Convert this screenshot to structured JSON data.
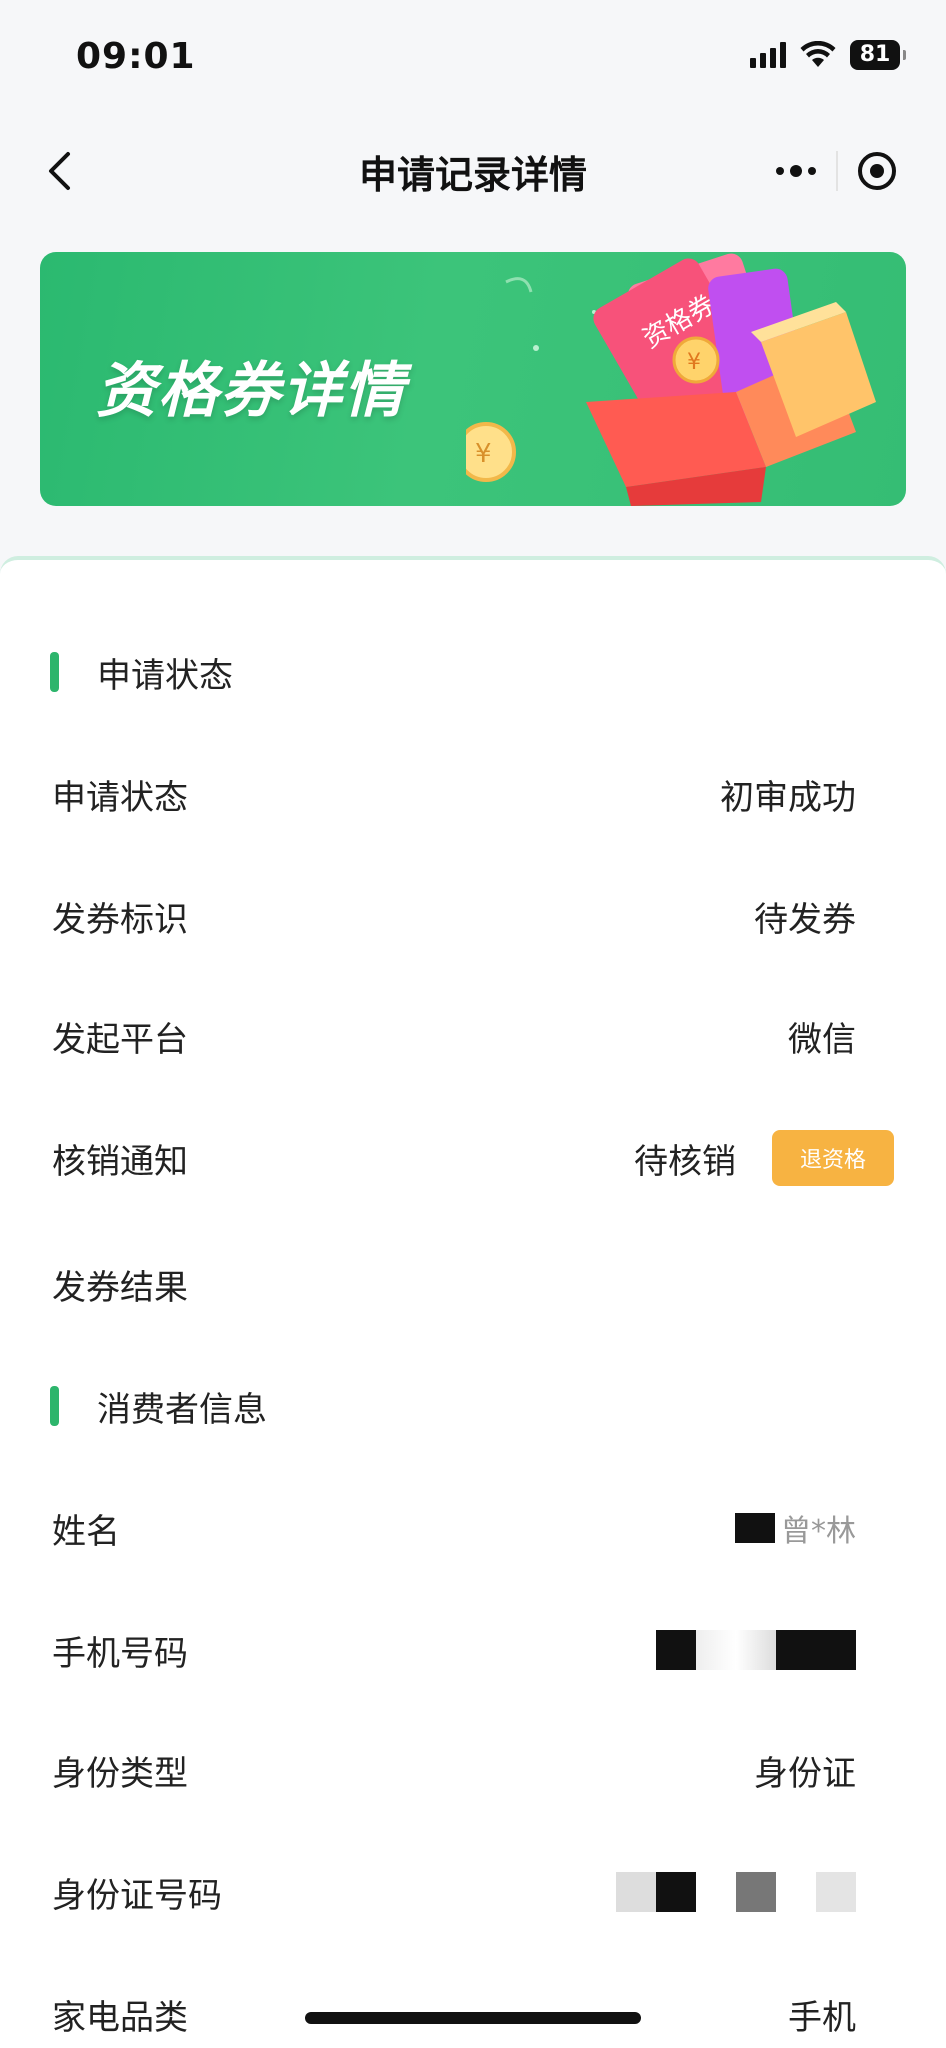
{
  "status_bar": {
    "time": "09:01",
    "battery": "81"
  },
  "nav": {
    "title": "申请记录详情"
  },
  "banner": {
    "title": "资格券详情",
    "ticket_text": "资格券",
    "currency_symbol": "¥"
  },
  "sections": {
    "status": {
      "title": "申请状态",
      "rows": [
        {
          "label": "申请状态",
          "value": "初审成功"
        },
        {
          "label": "发券标识",
          "value": "待发券"
        },
        {
          "label": "发起平台",
          "value": "微信"
        },
        {
          "label": "核销通知",
          "value": "待核销"
        },
        {
          "label": "发券结果",
          "value": ""
        }
      ],
      "refund_button": "退资格"
    },
    "consumer": {
      "title": "消费者信息",
      "rows": [
        {
          "label": "姓名",
          "value": "曾*林"
        },
        {
          "label": "手机号码",
          "value": ""
        },
        {
          "label": "身份类型",
          "value": "身份证"
        },
        {
          "label": "身份证号码",
          "value": ""
        },
        {
          "label": "家电品类",
          "value": "手机"
        }
      ]
    }
  }
}
